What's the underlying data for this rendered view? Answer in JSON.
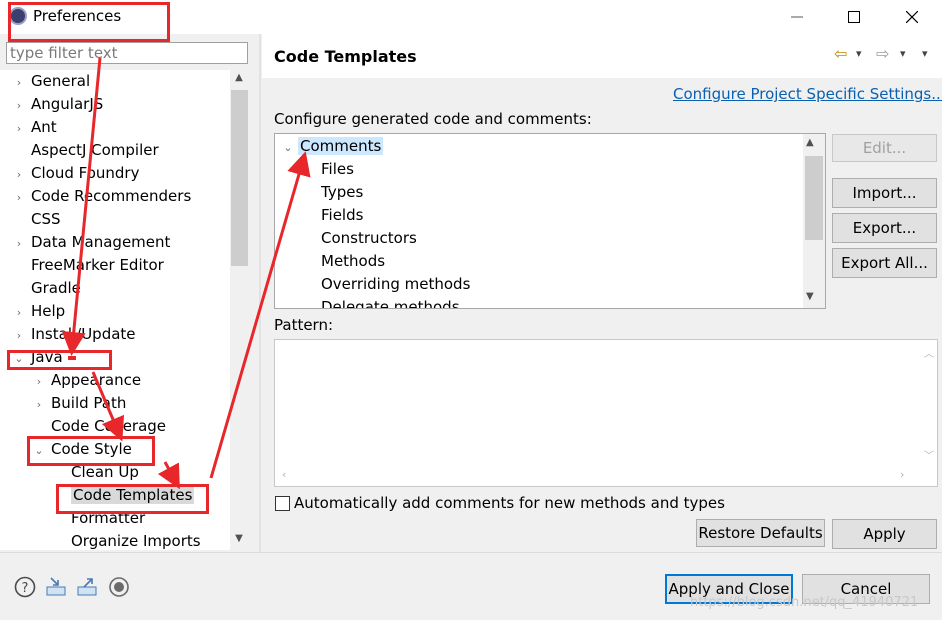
{
  "window": {
    "title": "Preferences",
    "minimize_glyph": "—",
    "maximize_glyph": "☐",
    "close_glyph": "✕"
  },
  "left": {
    "filter_placeholder": "type filter text",
    "tree": [
      {
        "label": "General",
        "expander": "›"
      },
      {
        "label": "AngularJS",
        "expander": "›"
      },
      {
        "label": "Ant",
        "expander": "›"
      },
      {
        "label": "AspectJ Compiler",
        "expander": ""
      },
      {
        "label": "Cloud Foundry",
        "expander": "›"
      },
      {
        "label": "Code Recommenders",
        "expander": "›"
      },
      {
        "label": "CSS",
        "expander": ""
      },
      {
        "label": "Data Management",
        "expander": "›"
      },
      {
        "label": "FreeMarker Editor",
        "expander": ""
      },
      {
        "label": "Gradle",
        "expander": ""
      },
      {
        "label": "Help",
        "expander": "›"
      },
      {
        "label": "Install/Update",
        "expander": "›"
      },
      {
        "label": "Java",
        "expander": "⌄"
      },
      {
        "label": "Appearance",
        "expander": "›"
      },
      {
        "label": "Build Path",
        "expander": "›"
      },
      {
        "label": "Code Coverage",
        "expander": ""
      },
      {
        "label": "Code Style",
        "expander": "⌄"
      },
      {
        "label": "Clean Up",
        "expander": ""
      },
      {
        "label": "Code Templates",
        "expander": ""
      },
      {
        "label": "Formatter",
        "expander": ""
      },
      {
        "label": "Organize Imports",
        "expander": ""
      }
    ]
  },
  "right": {
    "title": "Code Templates",
    "nav_back": "⇦",
    "nav_forward": "⇨",
    "nav_menu": "▾",
    "config_link": "Configure Project Specific Settings...",
    "config_label": "Configure generated code and comments:",
    "templates": [
      {
        "label": "Comments",
        "expander": "⌄"
      },
      {
        "label": "Files",
        "expander": ""
      },
      {
        "label": "Types",
        "expander": ""
      },
      {
        "label": "Fields",
        "expander": ""
      },
      {
        "label": "Constructors",
        "expander": ""
      },
      {
        "label": "Methods",
        "expander": ""
      },
      {
        "label": "Overriding methods",
        "expander": ""
      },
      {
        "label": "Delegate methods",
        "expander": ""
      }
    ],
    "buttons": {
      "edit": "Edit...",
      "import": "Import...",
      "export": "Export...",
      "export_all": "Export All..."
    },
    "pattern_label": "Pattern:",
    "auto_comment_label": "Automatically add comments for new methods and types",
    "auto_comment_checked": false,
    "restore_defaults": "Restore Defaults",
    "apply": "Apply"
  },
  "footer": {
    "apply_and_close": "Apply and Close",
    "cancel": "Cancel",
    "watermark": "https://blog.csdn.net/qq_41940721",
    "icons": [
      "help-icon",
      "import-icon",
      "export-icon",
      "record-icon"
    ]
  },
  "colors": {
    "annotation": "#e8272a",
    "link": "#0b5fb0",
    "default_button_border": "#0078d7"
  }
}
